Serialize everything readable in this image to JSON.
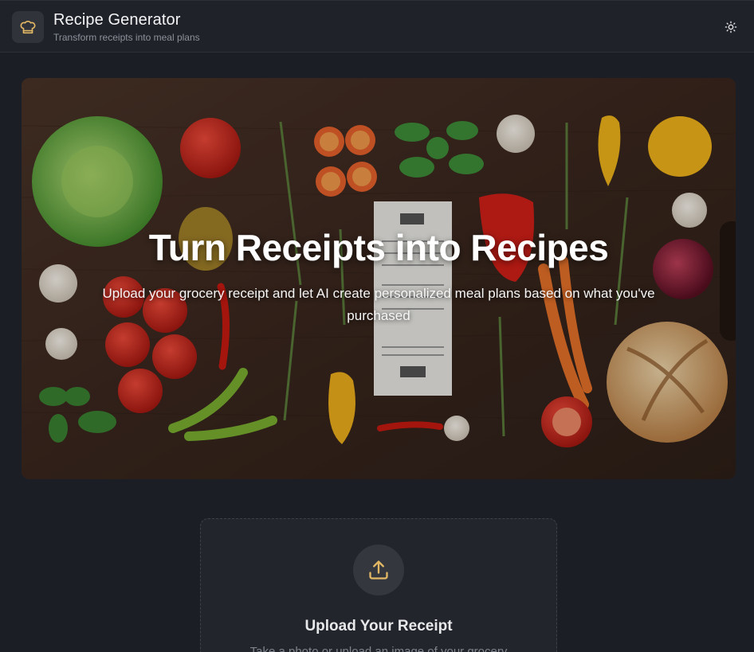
{
  "header": {
    "title": "Recipe Generator",
    "subtitle": "Transform receipts into meal plans",
    "logo_icon": "chef-hat-icon",
    "theme_icon": "sun-icon"
  },
  "hero": {
    "title": "Turn Receipts into Recipes",
    "description": "Upload your grocery receipt and let AI create personalized meal plans based on what you've purchased"
  },
  "upload": {
    "icon": "upload-icon",
    "title": "Upload Your Receipt",
    "description": "Take a photo or upload an image of your grocery"
  },
  "colors": {
    "background": "#1b1e24",
    "header": "#1f2229",
    "accent": "#e2b865",
    "card": "#22252c"
  }
}
